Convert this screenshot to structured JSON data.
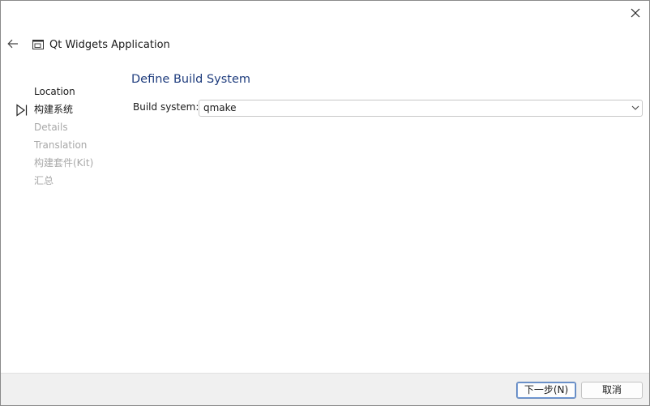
{
  "window": {
    "title": "Qt Widgets Application",
    "back_icon": "arrow-left-icon",
    "close_icon": "close-icon",
    "app_icon": "qt-project-icon"
  },
  "steps": [
    {
      "label": "Location",
      "state": "done"
    },
    {
      "label": "构建系统",
      "state": "current"
    },
    {
      "label": "Details",
      "state": "pending"
    },
    {
      "label": "Translation",
      "state": "pending"
    },
    {
      "label": "构建套件(Kit)",
      "state": "pending"
    },
    {
      "label": "汇总",
      "state": "pending"
    }
  ],
  "page": {
    "title": "Define Build System",
    "build_system_label": "Build system:",
    "build_system_value": "qmake"
  },
  "footer": {
    "next_label": "下一步(N)",
    "cancel_label": "取消"
  },
  "colors": {
    "title_accent": "#1e3c7d",
    "pending_text": "#a8a8a8",
    "footer_bg": "#f0f0f0"
  }
}
